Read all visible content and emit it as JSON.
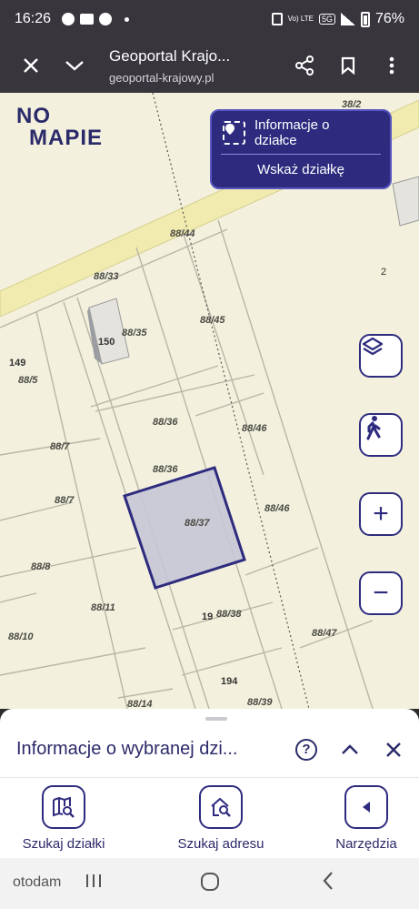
{
  "status_bar": {
    "time": "16:26",
    "battery": "76%",
    "network": "5G",
    "volte": "Vo) LTE"
  },
  "browser": {
    "title": "Geoportal Krajo...",
    "url": "geoportal-krajowy.pl"
  },
  "map": {
    "logo_line1": "NO",
    "logo_line2": "MAPIE",
    "info_panel": {
      "title": "Informacje o działce",
      "action": "Wskaż działkę"
    },
    "parcels": [
      "38/2",
      "88/44",
      "88/33",
      "88/35",
      "150",
      "88/45",
      "2",
      "149",
      "88/5",
      "88/36",
      "88/46",
      "88/7",
      "88/36",
      "88/7",
      "88/37",
      "88/46",
      "88/8",
      "88/11",
      "19",
      "88/38",
      "88/10",
      "88/47",
      "194",
      "88/14",
      "88/39"
    ],
    "controls": {
      "layers": "layers-icon",
      "person": "person-walking-icon",
      "zoom_in": "+",
      "zoom_out": "−"
    }
  },
  "sheet": {
    "title": "Informacje o wybranej dzi...",
    "tools": [
      {
        "label": "Szukaj działki",
        "icon": "map-search-icon"
      },
      {
        "label": "Szukaj adresu",
        "icon": "home-search-icon"
      },
      {
        "label": "Narzędzia",
        "icon": "chevron-left-icon"
      }
    ]
  },
  "navbar": {
    "brand": "otodam"
  }
}
